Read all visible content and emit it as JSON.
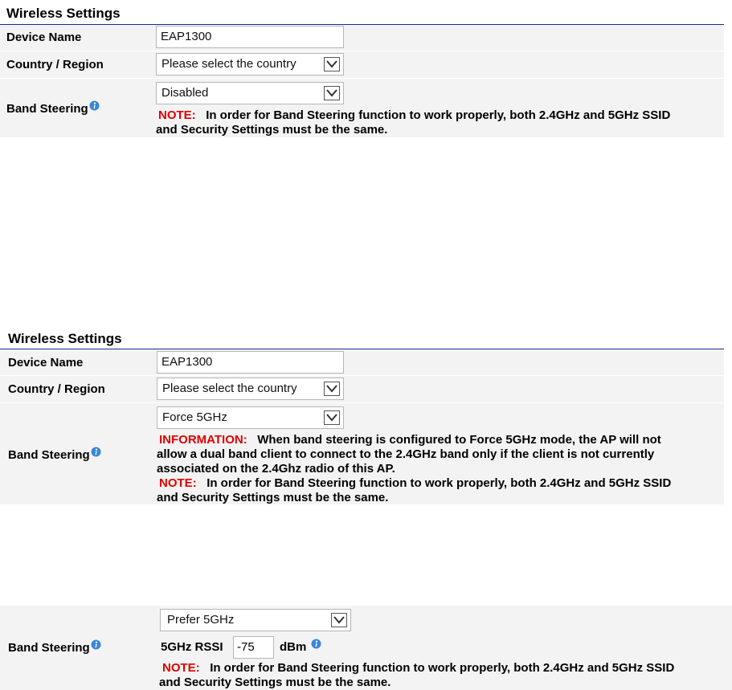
{
  "section1": {
    "title": "Wireless Settings",
    "device_name_label": "Device Name",
    "device_name_value": "EAP1300",
    "country_label": "Country / Region",
    "country_value": "Please select the country",
    "band_label": "Band Steering",
    "band_value": "Disabled",
    "note_prefix": "NOTE:",
    "note_text": "In order for Band Steering function to work properly, both 2.4GHz and 5GHz SSID",
    "note_text2": "and Security Settings must be the same."
  },
  "section2": {
    "title": "Wireless Settings",
    "device_name_label": "Device Name",
    "device_name_value": "EAP1300",
    "country_label": "Country / Region",
    "country_value": "Please select the country",
    "band_label": "Band Steering",
    "band_value": "Force 5GHz",
    "info_prefix": "INFORMATION:",
    "info_text1": "When band steering is configured to Force 5GHz mode, the AP will not",
    "info_text2": "allow a dual band client to connect to the 2.4GHz band only if the client is not currently",
    "info_text3": "associated on the 2.4Ghz radio of this AP.",
    "note_prefix": "NOTE:",
    "note_text": "In order for Band Steering function to work properly, both 2.4GHz and 5GHz SSID",
    "note_text2": "and Security Settings must be the same."
  },
  "section3": {
    "band_label": "Band Steering",
    "band_value": "Prefer 5GHz",
    "rssi_label": "5GHz RSSI",
    "rssi_value": "-75",
    "rssi_unit": "dBm",
    "note_prefix": "NOTE:",
    "note_text": "In order for Band Steering function to work properly, both 2.4GHz and 5GHz SSID",
    "note_text2": "and Security Settings must be the same."
  },
  "icons": {
    "info": "info-icon",
    "dropdown": "chevron-down-icon"
  },
  "colors": {
    "rule": "#1a2a8c",
    "note_red": "#e00000",
    "row_bg": "#f3f3f3"
  }
}
